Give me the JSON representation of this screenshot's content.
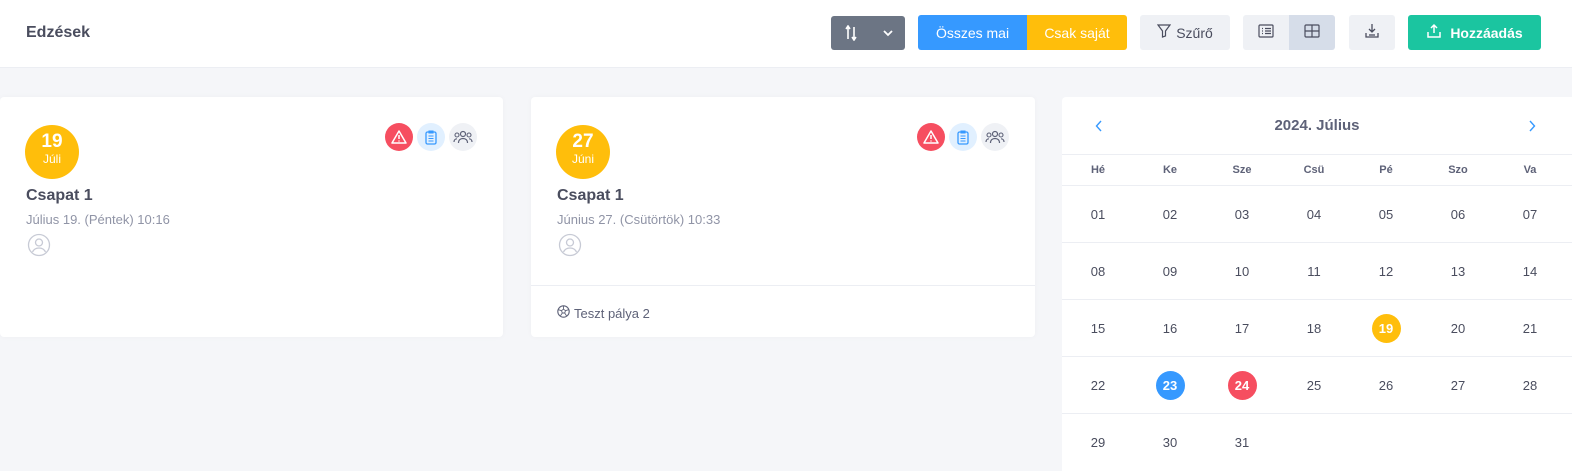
{
  "header": {
    "title": "Edzések",
    "buttons": {
      "all_today": "Összes mai",
      "own_only": "Csak saját",
      "filter": "Szűrő",
      "add": "Hozzáadás"
    }
  },
  "colors": {
    "primary": "#3699ff",
    "warning": "#ffbe0b",
    "success": "#1bc5a0",
    "danger": "#f64e60",
    "secondary": "#6c7584"
  },
  "cards": [
    {
      "day": "19",
      "month": "Júli",
      "team": "Csapat 1",
      "datetime": "Július 19. (Péntek) 10:16",
      "venue": ""
    },
    {
      "day": "27",
      "month": "Júni",
      "team": "Csapat 1",
      "datetime": "Június 27. (Csütörtök) 10:33",
      "venue": "Teszt pálya 2"
    }
  ],
  "calendar": {
    "title": "2024. Július",
    "weekdays": [
      "Hé",
      "Ke",
      "Sze",
      "Csü",
      "Pé",
      "Szo",
      "Va"
    ],
    "weeks": [
      [
        "01",
        "02",
        "03",
        "04",
        "05",
        "06",
        "07"
      ],
      [
        "08",
        "09",
        "10",
        "11",
        "12",
        "13",
        "14"
      ],
      [
        "15",
        "16",
        "17",
        "18",
        "19",
        "20",
        "21"
      ],
      [
        "22",
        "23",
        "24",
        "25",
        "26",
        "27",
        "28"
      ],
      [
        "29",
        "30",
        "31",
        "",
        "",
        "",
        ""
      ]
    ],
    "highlights": {
      "19": "yellow",
      "23": "blue",
      "24": "red"
    }
  }
}
